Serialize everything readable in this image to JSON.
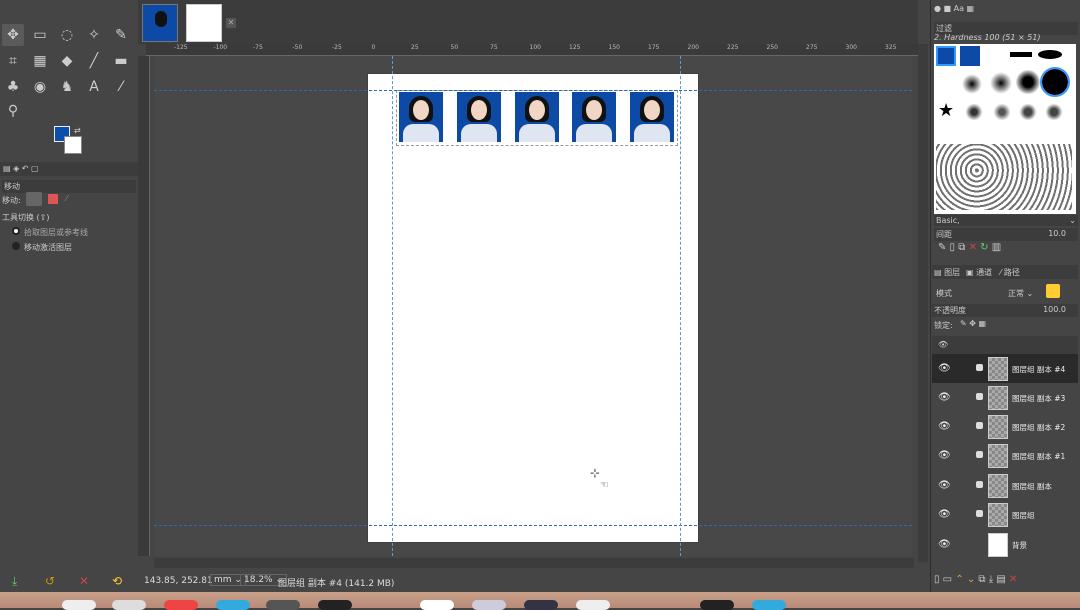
{
  "tool_options": {
    "title": "移动",
    "move_label": "移动:",
    "tool_toggle": "工具切换 (⇧)",
    "option_pick": "拾取图层或参考线",
    "option_active": "移动激活图层"
  },
  "status": {
    "coords": "143.85, 252.81",
    "unit": "mm",
    "zoom": "18.2%",
    "layer_info": "图层组 副本 #4 (141.2 MB)"
  },
  "brushes": {
    "filter_label": "过滤",
    "current": "2. Hardness 100 (51 × 51)",
    "preset": "Basic,",
    "spacing_label": "间距",
    "spacing_value": "10.0"
  },
  "layers_panel": {
    "tabs": [
      "图层",
      "通道",
      "路径"
    ],
    "mode_label": "模式",
    "mode_value": "正常",
    "opacity_label": "不透明度",
    "opacity_value": "100.0",
    "lock_label": "锁定:"
  },
  "layers": [
    {
      "name": "图层组 副本 #4",
      "type": "group",
      "selected": true
    },
    {
      "name": "图层组 副本 #3",
      "type": "group"
    },
    {
      "name": "图层组 副本 #2",
      "type": "group"
    },
    {
      "name": "图层组 副本 #1",
      "type": "group"
    },
    {
      "name": "图层组 副本",
      "type": "group"
    },
    {
      "name": "图层组",
      "type": "group"
    },
    {
      "name": "背景",
      "type": "background"
    }
  ],
  "ruler_ticks": [
    "-125",
    "-100",
    "-75",
    "-50",
    "-25",
    "0",
    "25",
    "50",
    "75",
    "100",
    "125",
    "150",
    "175",
    "200",
    "225",
    "250",
    "275",
    "300",
    "325"
  ],
  "colors": {
    "foreground": "#0a4fb0",
    "background": "#ffffff",
    "photo_bg": "#0d4aa6"
  }
}
